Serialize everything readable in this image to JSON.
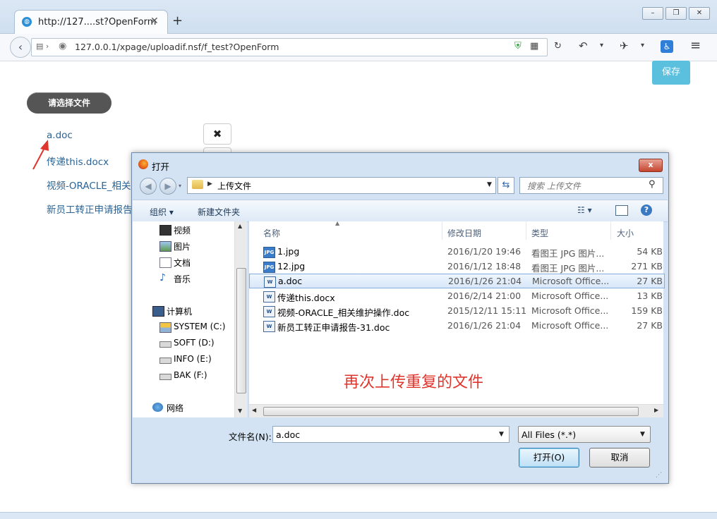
{
  "browser": {
    "tab_title": "http://127....st?OpenForm",
    "new_tab": "+",
    "url": "127.0.0.1/xpage/uploadif.nsf/f_test?OpenForm",
    "window_buttons": [
      "–",
      "❐",
      "✕"
    ]
  },
  "page": {
    "save_label": "保存",
    "choose_label": "请选择文件",
    "files": [
      "a.doc",
      "传递this.docx",
      "视频-ORACLE_相关",
      "新员工转正申请报告"
    ],
    "delete_symbol": "✖"
  },
  "dialog": {
    "title": "打开",
    "close": "x",
    "path": "上传文件",
    "search_placeholder": "搜索 上传文件",
    "toolbar": {
      "organize": "组织 ▾",
      "new_folder": "新建文件夹",
      "help": "?"
    },
    "nav": [
      {
        "label": "视频",
        "icon": "video-icon"
      },
      {
        "label": "图片",
        "icon": "picture-icon"
      },
      {
        "label": "文档",
        "icon": "document-icon"
      },
      {
        "label": "音乐",
        "icon": "music-icon"
      },
      {
        "label": "计算机",
        "icon": "computer-icon"
      },
      {
        "label": "SYSTEM (C:)",
        "icon": "drive-icon"
      },
      {
        "label": "SOFT (D:)",
        "icon": "drive-icon"
      },
      {
        "label": "INFO (E:)",
        "icon": "drive-icon"
      },
      {
        "label": "BAK (F:)",
        "icon": "drive-icon"
      },
      {
        "label": "网络",
        "icon": "network-icon"
      }
    ],
    "columns": [
      "名称",
      "修改日期",
      "类型",
      "大小"
    ],
    "files": [
      {
        "name": "1.jpg",
        "date": "2016/1/20 19:46",
        "type": "看图王 JPG 图片...",
        "size": "54 KB",
        "icon": "jpg-icon",
        "selected": false
      },
      {
        "name": "12.jpg",
        "date": "2016/1/12 18:48",
        "type": "看图王 JPG 图片...",
        "size": "271 KB",
        "icon": "jpg-icon",
        "selected": false
      },
      {
        "name": "a.doc",
        "date": "2016/1/26 21:04",
        "type": "Microsoft Office...",
        "size": "27 KB",
        "icon": "word-icon",
        "selected": true
      },
      {
        "name": "传递this.docx",
        "date": "2016/2/14 21:00",
        "type": "Microsoft Office...",
        "size": "13 KB",
        "icon": "word-icon",
        "selected": false
      },
      {
        "name": "视频-ORACLE_相关维护操作.doc",
        "date": "2015/12/11 15:11",
        "type": "Microsoft Office...",
        "size": "159 KB",
        "icon": "word-icon",
        "selected": false
      },
      {
        "name": "新员工转正申请报告-31.doc",
        "date": "2016/1/26 21:04",
        "type": "Microsoft Office...",
        "size": "27 KB",
        "icon": "word-icon",
        "selected": false
      }
    ],
    "filename_label": "文件名(N):",
    "filename_value": "a.doc",
    "filter_value": "All Files (*.*)",
    "open_label": "打开(O)",
    "cancel_label": "取消"
  },
  "annotation": {
    "text": "再次上传重复的文件",
    "color": "#e0352c"
  }
}
